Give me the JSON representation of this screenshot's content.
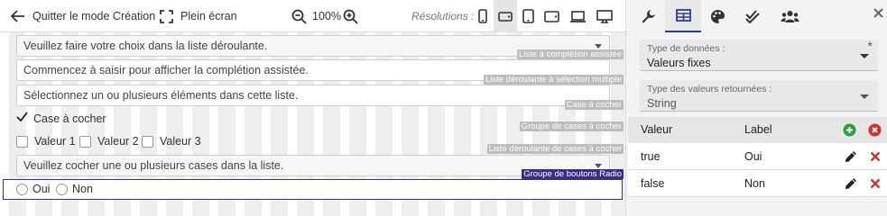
{
  "toolbar": {
    "quit_label": "Quitter le mode Création",
    "fullscreen_label": "Plein écran",
    "zoom_value": "100%",
    "resolutions_label": "Résolutions :",
    "devices": [
      "phone-portrait",
      "phone-landscape",
      "tablet-portrait",
      "tablet-landscape",
      "laptop",
      "desktop"
    ],
    "active_device": "phone-landscape"
  },
  "canvas": {
    "fields": {
      "select_placeholder": "Veuillez faire votre choix dans la liste déroulante.",
      "select_tag": "Liste à complétion assistée",
      "autocomplete_placeholder": "Commencez à saisir pour afficher la complétion assistée.",
      "autocomplete_tag": "Liste déroulante à sélection multiple",
      "multiselect_placeholder": "Sélectionnez un ou plusieurs éléments dans cette liste.",
      "multiselect_tag": "Case à cocher",
      "checkbox_label": "Case à cocher",
      "checkbox_tag": "Groupe de cases à cocher",
      "checkbox_group": [
        "Valeur 1",
        "Valeur 2",
        "Valeur 3"
      ],
      "checkbox_group_tag": "Liste déroulante de cases à cocher",
      "checkbox_dropdown_placeholder": "Veuillez cocher une ou plusieurs cases dans la liste.",
      "checkbox_dropdown_tag": "Groupe de boutons Radio",
      "radio_options": [
        "Oui",
        "Non"
      ]
    }
  },
  "panel": {
    "tabs": [
      "wrench-icon",
      "table-icon",
      "palette-icon",
      "double-check-icon",
      "users-icon"
    ],
    "active_tab": "table-icon",
    "data_type": {
      "label": "Type de données :",
      "value": "Valeurs fixes",
      "required_mark": "*"
    },
    "return_type": {
      "label": "Type des valeurs retournées :",
      "value": "String"
    },
    "table": {
      "headers": {
        "value": "Valeur",
        "label": "Label"
      },
      "rows": [
        {
          "value": "true",
          "label": "Oui"
        },
        {
          "value": "false",
          "label": "Non"
        }
      ]
    },
    "colors": {
      "add": "#2e9e3f",
      "remove": "#d32f2f",
      "accent": "#2a3d8f",
      "selected_tag": "#3f2a8a"
    }
  }
}
